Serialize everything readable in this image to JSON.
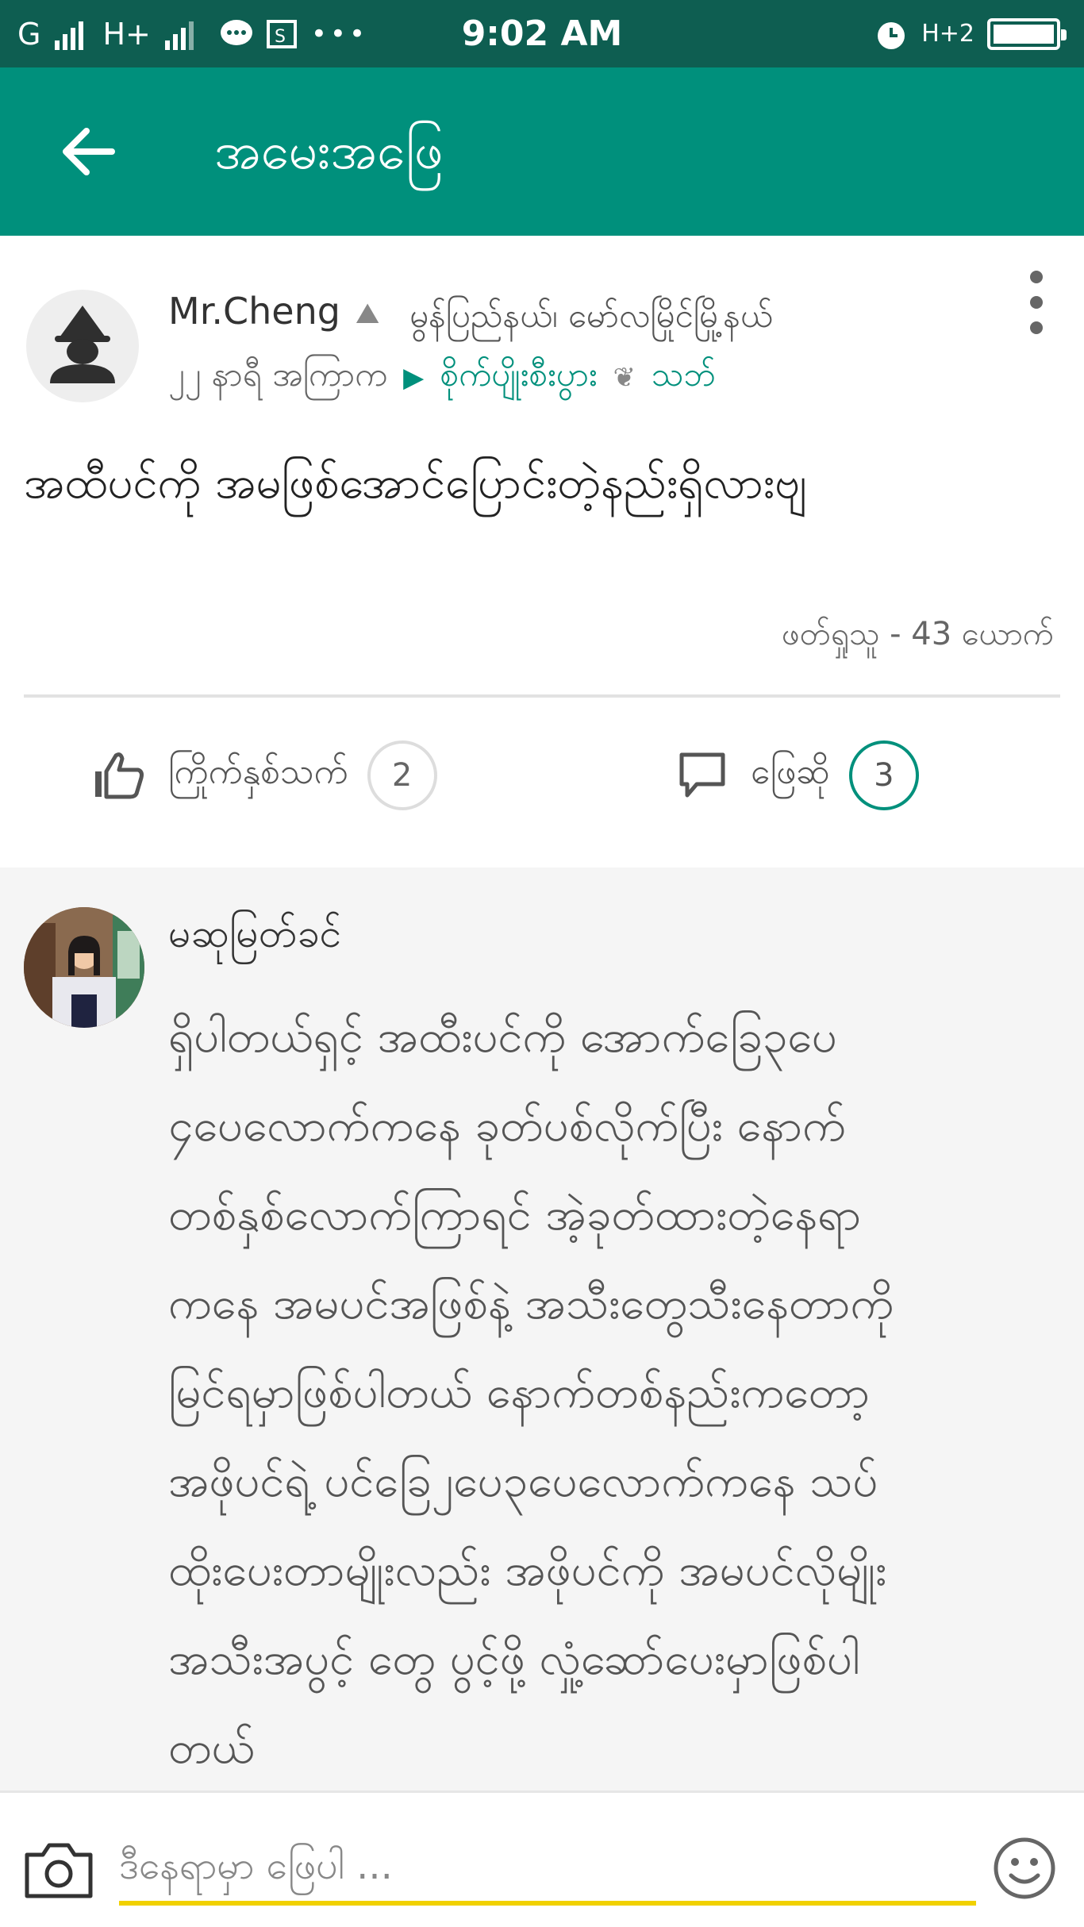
{
  "status_bar": {
    "carrier1": "G",
    "carrier2": "H+",
    "time": "9:02 AM",
    "network_right": "H+2"
  },
  "app_bar": {
    "title": "အမေးအဖြေ"
  },
  "post": {
    "author": "Mr.Cheng",
    "location": "မွန်ပြည်နယ်၊ မော်လမြိုင်မြို့နယ်",
    "time_ago": "၂၂ နာရီ အကြာက",
    "topic": "စိုက်ပျိုးစီးပွား",
    "crop": "သဘ်",
    "question": "အထီပင်ကို အမဖြစ်အောင်ပြောင်းတဲ့နည်းရှိလားဗျ",
    "views": "ဖတ်ရှုသူ - 43 ယောက်",
    "like_label": "ကြိုက်နှစ်သက်",
    "like_count": "2",
    "answer_label": "ဖြေဆို",
    "answer_count": "3"
  },
  "answer": {
    "author": "မဆုမြတ်ခင်",
    "lines": [
      "ရှိပါတယ်ရှင့် အထီးပင်ကို အောက်ခြေ၃ပေ",
      "၄ပေလောက်ကနေ ခုတ်ပစ်လိုက်ပြီး နောက်",
      "တစ်နှစ်လောက်ကြာရင် အဲ့ခုတ်ထားတဲ့နေရာ",
      "ကနေ အမပင်အဖြစ်နဲ့ အသီးတွေသီးနေတာကို",
      "မြင်ရမှာဖြစ်ပါတယ် နောက်တစ်နည်းကတော့",
      "အဖိုပင်ရဲ့ ပင်ခြေ၂ပေ၃ပေလောက်ကနေ သပ်",
      "ထိုးပေးတာမျိုးလည်း အဖိုပင်ကို အမပင်လိုမျိုး",
      "အသီးအပွင့် တွေ ပွင့်ဖို့ လှုံ့ဆော်ပေးမှာဖြစ်ပါ",
      "တယ်"
    ]
  },
  "input": {
    "placeholder": "ဒီနေရာမှာ ဖြေပါ ..."
  },
  "colors": {
    "status_bar": "#0e5e51",
    "app_bar": "#00907c",
    "accent": "#00907c",
    "input_underline": "#f1d100"
  }
}
